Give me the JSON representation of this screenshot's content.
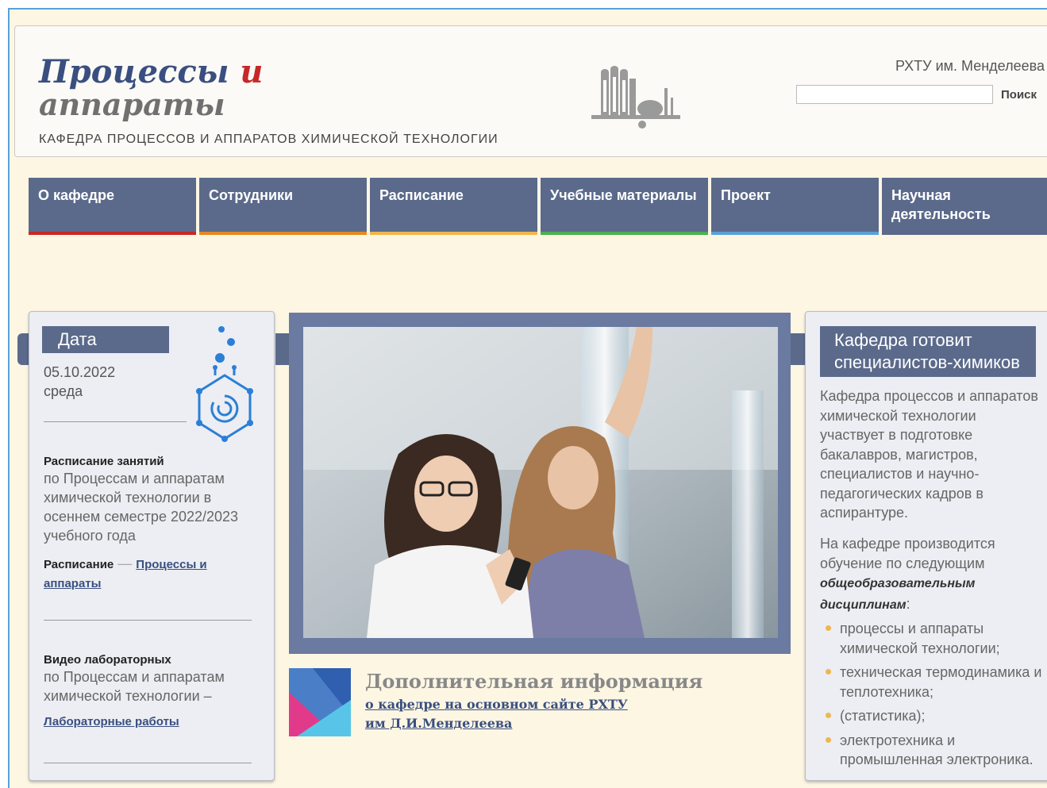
{
  "header": {
    "logo_line1_a": "Процессы",
    "logo_line1_b": "и",
    "logo_line2": "аппараты",
    "tagline": "КАФЕДРА ПРОЦЕССОВ И АППАРАТОВ ХИМИЧЕСКОЙ ТЕХНОЛОГИИ",
    "university": "РХТУ им. Менделеева",
    "search_button": "Поиск",
    "search_value": ""
  },
  "nav": {
    "items": [
      {
        "label": "О кафедре",
        "accent": "#c62828"
      },
      {
        "label": "Сотрудники",
        "accent": "#e58a1f"
      },
      {
        "label": "Расписание",
        "accent": "#f0b64c"
      },
      {
        "label": "Учебные материалы",
        "accent": "#4caf50"
      },
      {
        "label": "Проект",
        "accent": "#5aa0d8"
      },
      {
        "label": "Научная деятельность",
        "accent": "#5b6a8b"
      }
    ]
  },
  "left_panel": {
    "date_label": "Дата",
    "date": "05.10.2022",
    "weekday": "среда",
    "schedule_title": "Расписание занятий",
    "schedule_text": "по Процессам и аппаратам химической технологии в осеннем семестре 2022/2023 учебного года",
    "schedule_label": "Расписание",
    "schedule_dash": "—",
    "schedule_link": "Процессы и аппараты",
    "video_title": "Видео лабораторных",
    "video_text": "по Процессам и аппаратам химической технологии  –",
    "video_link": "Лабораторные работы"
  },
  "center": {
    "info_title": "Дополнительная информация",
    "info_link_line1": "о кафедре на основном сайте РХТУ",
    "info_link_line2": "им Д.И.Менделеева"
  },
  "right_panel": {
    "heading": "Кафедра готовит специалистов-химиков",
    "paragraph1": "Кафедра процессов и аппаратов химической технологии участвует в подготовке бакалавров, магистров, специалистов и научно-педагогических кадров в аспирантуре.",
    "paragraph2_lead": "На кафедре  производится обучение по следующим",
    "paragraph2_em": "общеобразовательным дисциплинам",
    "paragraph2_end": ":",
    "disciplines": [
      "процессы и аппараты химической технологии;",
      "техническая термодинамика и теплотехника;",
      "(статистика);",
      "электротехника и промышленная электроника."
    ]
  },
  "colors": {
    "nav_bg": "#5b6a8b",
    "page_bg": "#fdf6e3",
    "brand_blue": "#3a4f80",
    "brand_red": "#c62828"
  }
}
